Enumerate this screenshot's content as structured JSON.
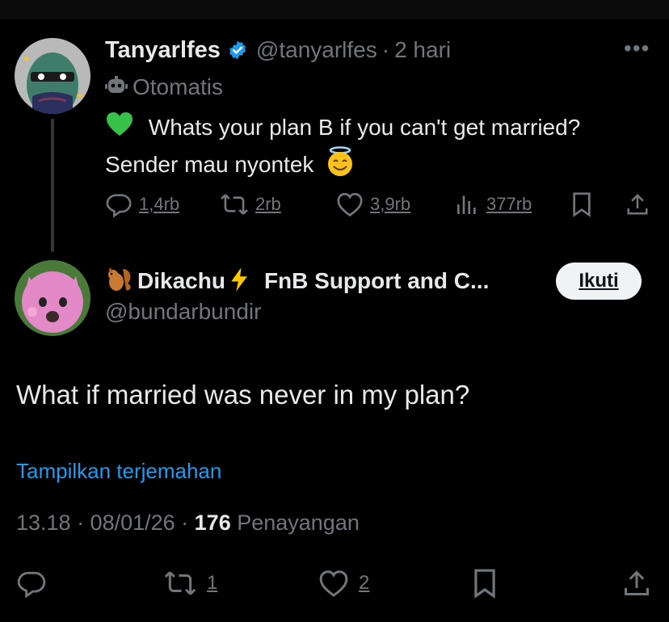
{
  "parent": {
    "name": "Tanyarlfes",
    "handle": "@tanyarlfes",
    "separator": "·",
    "time": "2 hari",
    "automated_label": "Otomatis",
    "text_line1": "Whats your plan B if you can't get married?",
    "text_line2": "Sender mau nyontek",
    "metrics": {
      "replies": "1,4rb",
      "reposts": "2rb",
      "likes": "3,9rb",
      "views": "377rb"
    }
  },
  "reply": {
    "name_part1": "Dikachu",
    "name_part2": "FnB Support and C...",
    "handle": "@bundarbundir",
    "follow_label": "Ikuti",
    "text": "What if married was never in my plan?",
    "translate_label": "Tampilkan terjemahan",
    "meta_time": "13.18 · 08/01/26 · ",
    "meta_views_count": "176",
    "meta_views_label": " Penayangan",
    "reposts": "1",
    "likes": "2"
  },
  "colors": {
    "background": "#000000",
    "text": "#e7e9ea",
    "muted": "#71767b",
    "link": "#1d9bf0",
    "verified": "#1d9bf0"
  }
}
